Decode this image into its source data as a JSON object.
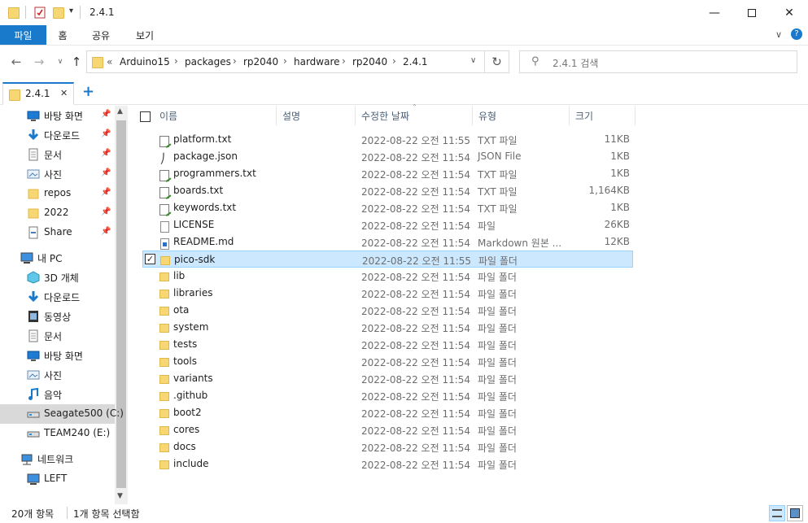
{
  "window": {
    "title": "2.4.1",
    "minimize_icon": "minimize-icon",
    "maximize_icon": "maximize-icon",
    "close_icon": "close-icon"
  },
  "ribbon": {
    "tabs": [
      {
        "label": "파일",
        "active": true
      },
      {
        "label": "홈",
        "active": false
      },
      {
        "label": "공유",
        "active": false
      },
      {
        "label": "보기",
        "active": false
      }
    ]
  },
  "address": {
    "overflow": "«",
    "crumbs": [
      "Arduino15",
      "packages",
      "rp2040",
      "hardware",
      "rp2040",
      "2.4.1"
    ]
  },
  "search": {
    "placeholder": "2.4.1 검색"
  },
  "tabbar": {
    "tab_label": "2.4.1",
    "close_glyph": "✕",
    "add_glyph": "+"
  },
  "sidebar": {
    "quick_access": [
      {
        "label": "바탕 화면",
        "icon": "desktop-icon",
        "pinned": true
      },
      {
        "label": "다운로드",
        "icon": "download-icon",
        "pinned": true
      },
      {
        "label": "문서",
        "icon": "document-icon",
        "pinned": true
      },
      {
        "label": "사진",
        "icon": "pictures-icon",
        "pinned": true
      },
      {
        "label": "repos",
        "icon": "folder-icon",
        "pinned": true
      },
      {
        "label": "2022",
        "icon": "folder-icon",
        "pinned": true
      },
      {
        "label": "Share",
        "icon": "share-icon",
        "pinned": true
      }
    ],
    "this_pc": {
      "label": "내 PC",
      "items": [
        {
          "label": "3D 개체",
          "icon": "3d-objects-icon"
        },
        {
          "label": "다운로드",
          "icon": "download-icon"
        },
        {
          "label": "동영상",
          "icon": "video-icon"
        },
        {
          "label": "문서",
          "icon": "document-icon"
        },
        {
          "label": "바탕 화면",
          "icon": "desktop-icon"
        },
        {
          "label": "사진",
          "icon": "pictures-icon"
        },
        {
          "label": "음악",
          "icon": "music-icon"
        },
        {
          "label": "Seagate500 (C:)",
          "icon": "drive-icon",
          "selected": true
        },
        {
          "label": "TEAM240 (E:)",
          "icon": "drive-icon"
        }
      ]
    },
    "network": {
      "label": "네트워크",
      "items": [
        {
          "label": "LEFT",
          "icon": "computer-icon"
        }
      ]
    }
  },
  "columns": {
    "name": "이름",
    "desc": "설명",
    "date": "수정한 날짜",
    "type": "유형",
    "size": "크기"
  },
  "files": [
    {
      "name": "platform.txt",
      "date": "2022-08-22 오전 11:55",
      "type": "TXT 파일",
      "size": "11KB",
      "kind": "txt"
    },
    {
      "name": "package.json",
      "date": "2022-08-22 오전 11:54",
      "type": "JSON File",
      "size": "1KB",
      "kind": "json"
    },
    {
      "name": "programmers.txt",
      "date": "2022-08-22 오전 11:54",
      "type": "TXT 파일",
      "size": "1KB",
      "kind": "txt"
    },
    {
      "name": "boards.txt",
      "date": "2022-08-22 오전 11:54",
      "type": "TXT 파일",
      "size": "1,164KB",
      "kind": "txt"
    },
    {
      "name": "keywords.txt",
      "date": "2022-08-22 오전 11:54",
      "type": "TXT 파일",
      "size": "1KB",
      "kind": "txt"
    },
    {
      "name": "LICENSE",
      "date": "2022-08-22 오전 11:54",
      "type": "파일",
      "size": "26KB",
      "kind": "doc"
    },
    {
      "name": "README.md",
      "date": "2022-08-22 오전 11:54",
      "type": "Markdown 원본 ...",
      "size": "12KB",
      "kind": "md"
    },
    {
      "name": "pico-sdk",
      "date": "2022-08-22 오전 11:55",
      "type": "파일 폴더",
      "size": "",
      "kind": "folder",
      "selected": true
    },
    {
      "name": "lib",
      "date": "2022-08-22 오전 11:54",
      "type": "파일 폴더",
      "size": "",
      "kind": "folder"
    },
    {
      "name": "libraries",
      "date": "2022-08-22 오전 11:54",
      "type": "파일 폴더",
      "size": "",
      "kind": "folder"
    },
    {
      "name": "ota",
      "date": "2022-08-22 오전 11:54",
      "type": "파일 폴더",
      "size": "",
      "kind": "folder"
    },
    {
      "name": "system",
      "date": "2022-08-22 오전 11:54",
      "type": "파일 폴더",
      "size": "",
      "kind": "folder"
    },
    {
      "name": "tests",
      "date": "2022-08-22 오전 11:54",
      "type": "파일 폴더",
      "size": "",
      "kind": "folder"
    },
    {
      "name": "tools",
      "date": "2022-08-22 오전 11:54",
      "type": "파일 폴더",
      "size": "",
      "kind": "folder"
    },
    {
      "name": "variants",
      "date": "2022-08-22 오전 11:54",
      "type": "파일 폴더",
      "size": "",
      "kind": "folder"
    },
    {
      "name": ".github",
      "date": "2022-08-22 오전 11:54",
      "type": "파일 폴더",
      "size": "",
      "kind": "folder"
    },
    {
      "name": "boot2",
      "date": "2022-08-22 오전 11:54",
      "type": "파일 폴더",
      "size": "",
      "kind": "folder"
    },
    {
      "name": "cores",
      "date": "2022-08-22 오전 11:54",
      "type": "파일 폴더",
      "size": "",
      "kind": "folder"
    },
    {
      "name": "docs",
      "date": "2022-08-22 오전 11:54",
      "type": "파일 폴더",
      "size": "",
      "kind": "folder"
    },
    {
      "name": "include",
      "date": "2022-08-22 오전 11:54",
      "type": "파일 폴더",
      "size": "",
      "kind": "folder"
    }
  ],
  "status": {
    "count": "20개 항목",
    "selection": "1개 항목 선택함"
  },
  "colors": {
    "accent": "#1979ca",
    "selection_bg": "#cce8ff",
    "selection_border": "#99d1ff",
    "folder": "#f7d774"
  }
}
